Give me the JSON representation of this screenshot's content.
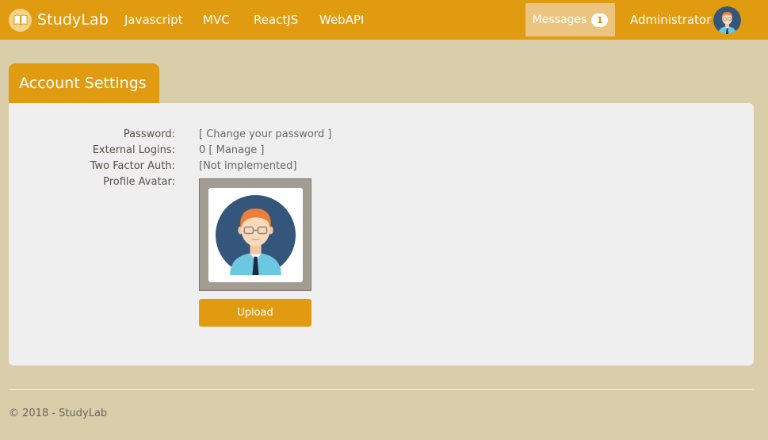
{
  "navbar": {
    "brand": "StudyLab",
    "brand_icon": "open-book-icon",
    "links": [
      "Javascript",
      "MVC",
      "ReactJS",
      "WebAPI"
    ],
    "messages_label": "Messages",
    "messages_count": "1",
    "user_name": "Administrator",
    "accent_color": "#e09b10"
  },
  "page": {
    "title": "Account Settings"
  },
  "settings": {
    "password_label": "Password:",
    "password_value": "[ Change your password ]",
    "external_logins_label": "External Logins:",
    "external_logins_value": "0 [ Manage ]",
    "two_factor_label": "Two Factor Auth:",
    "two_factor_value": "[Not implemented]",
    "profile_avatar_label": "Profile Avatar:",
    "avatar_icon": "user-avatar-icon",
    "upload_label": "Upload"
  },
  "footer": {
    "text": "© 2018 - StudyLab"
  }
}
